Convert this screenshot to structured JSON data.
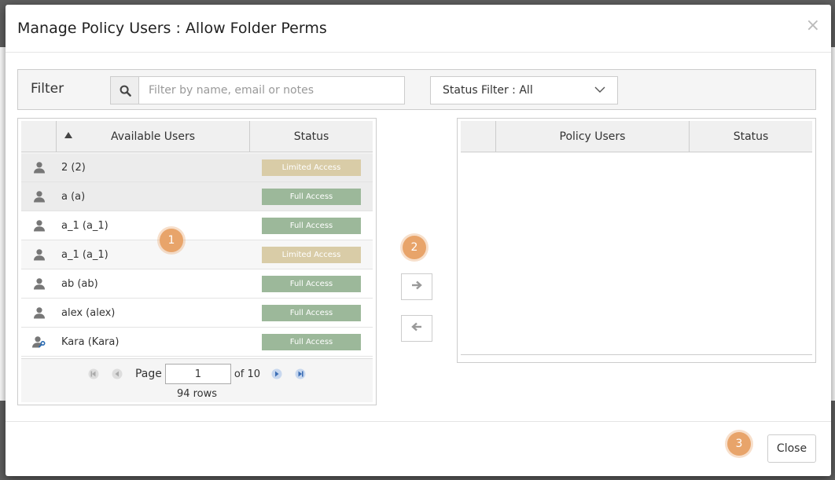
{
  "modal": {
    "title": "Manage Policy Users : Allow Folder Perms",
    "close_glyph": "×"
  },
  "filter": {
    "label": "Filter",
    "search_placeholder": "Filter by name, email or notes",
    "status_filter": "Status Filter : All"
  },
  "available": {
    "header_name": "Available Users",
    "header_status": "Status",
    "rows": [
      {
        "name": "2 (2)",
        "status": "Limited Access",
        "icon": "user-icon"
      },
      {
        "name": "a (a)",
        "status": "Full Access",
        "icon": "user-icon"
      },
      {
        "name": "a_1 (a_1)",
        "status": "Full Access",
        "icon": "user-icon"
      },
      {
        "name": "a_1 (a_1)",
        "status": "Limited Access",
        "icon": "user-icon"
      },
      {
        "name": "ab (ab)",
        "status": "Full Access",
        "icon": "user-icon"
      },
      {
        "name": "alex (alex)",
        "status": "Full Access",
        "icon": "user-icon"
      },
      {
        "name": "Kara  (Kara)",
        "status": "Full Access",
        "icon": "user-key-icon"
      }
    ],
    "pager": {
      "page_label": "Page",
      "page_value": "1",
      "of_label": "of 10",
      "rows_label": "94 rows"
    }
  },
  "policy": {
    "header_name": "Policy Users",
    "header_status": "Status"
  },
  "footer": {
    "close_label": "Close"
  },
  "callouts": [
    "1",
    "2",
    "3"
  ],
  "colors": {
    "full_access": "#9cb89a",
    "limited_access": "#d9cca7",
    "callout": "#e8a46a"
  }
}
